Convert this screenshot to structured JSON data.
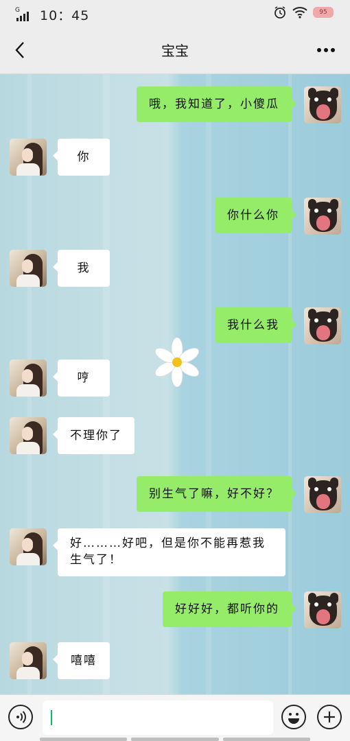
{
  "status_bar": {
    "time": "10：45",
    "network": "G",
    "battery": "95"
  },
  "header": {
    "title": "宝宝"
  },
  "messages": [
    {
      "side": "right",
      "text": "哦，我知道了，小傻瓜"
    },
    {
      "side": "left",
      "text": "你"
    },
    {
      "side": "right",
      "text": "你什么你"
    },
    {
      "side": "left",
      "text": "我"
    },
    {
      "side": "right",
      "text": "我什么我"
    },
    {
      "side": "left",
      "text": "哼"
    },
    {
      "side": "left",
      "text": "不理你了"
    },
    {
      "side": "right",
      "text": "别生气了嘛，好不好？"
    },
    {
      "side": "left",
      "text": "好………好吧，但是你不能再惹我生气了！"
    },
    {
      "side": "right",
      "text": "好好好，都听你的"
    },
    {
      "side": "left",
      "text": "嘻嘻"
    }
  ],
  "input": {
    "value": ""
  },
  "colors": {
    "sent_bubble": "#95ec69",
    "received_bubble": "#ffffff",
    "caret": "#07c160"
  },
  "icons": [
    "back-arrow-icon",
    "more-dots-icon",
    "voice-icon",
    "emoji-icon",
    "plus-icon",
    "daisy-sticker"
  ]
}
